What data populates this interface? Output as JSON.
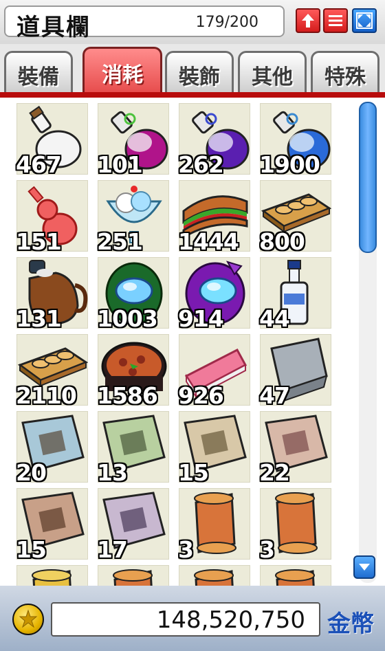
{
  "window": {
    "title": "道具欄",
    "capacity": "179/200"
  },
  "tabs": [
    {
      "label": "裝備",
      "active": false
    },
    {
      "label": "消耗",
      "active": true
    },
    {
      "label": "裝飾",
      "active": false
    },
    {
      "label": "其他",
      "active": false
    },
    {
      "label": "特殊",
      "active": false
    }
  ],
  "items": [
    {
      "icon": "white-potion-icon",
      "qty": "467"
    },
    {
      "icon": "magenta-potion-icon",
      "qty": "101"
    },
    {
      "icon": "purple-potion-icon",
      "qty": "262"
    },
    {
      "icon": "blue-potion-icon",
      "qty": "1900"
    },
    {
      "icon": "red-gourd-icon",
      "qty": "151"
    },
    {
      "icon": "parfait-icon",
      "qty": "251"
    },
    {
      "icon": "sandwich-icon",
      "qty": "1444"
    },
    {
      "icon": "sushi-plate-icon",
      "qty": "800"
    },
    {
      "icon": "jug-icon",
      "qty": "131"
    },
    {
      "icon": "green-orb-icon",
      "qty": "1003"
    },
    {
      "icon": "purple-orb-icon",
      "qty": "914"
    },
    {
      "icon": "bottle-icon",
      "qty": "44"
    },
    {
      "icon": "sushi-plate-icon",
      "qty": "2110"
    },
    {
      "icon": "pizza-icon",
      "qty": "1586"
    },
    {
      "icon": "cake-slice-icon",
      "qty": "926"
    },
    {
      "icon": "grey-scroll-icon",
      "qty": "47"
    },
    {
      "icon": "blue-scroll-icon",
      "qty": "20"
    },
    {
      "icon": "green-scroll-icon",
      "qty": "13"
    },
    {
      "icon": "tan-scroll-icon",
      "qty": "15"
    },
    {
      "icon": "pink-scroll-icon",
      "qty": "22"
    },
    {
      "icon": "brown-scroll-icon",
      "qty": "15"
    },
    {
      "icon": "lavender-scroll-icon",
      "qty": "17"
    },
    {
      "icon": "orange-scroll-icon",
      "qty": "3"
    },
    {
      "icon": "orange-scroll-icon",
      "qty": "3"
    },
    {
      "icon": "yellow-scroll-icon",
      "qty": ""
    },
    {
      "icon": "orange-scroll-icon",
      "qty": ""
    },
    {
      "icon": "orange-scroll-icon",
      "qty": ""
    },
    {
      "icon": "orange-scroll-icon",
      "qty": ""
    }
  ],
  "footer": {
    "money": "148,520,750",
    "currency_label": "金幣"
  },
  "colors": {
    "accent_red": "#b80c0c",
    "tab_active": "#e54848",
    "money_label": "#1a50b8"
  }
}
